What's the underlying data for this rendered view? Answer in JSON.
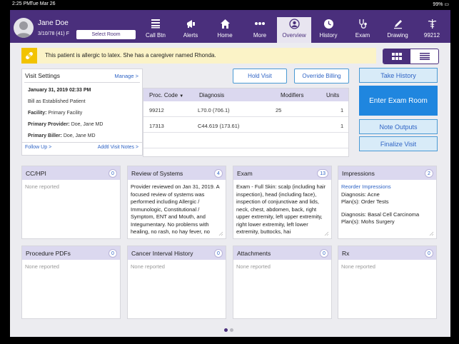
{
  "status_bar": {
    "time": "2:25 PM",
    "date": "Tue Mar 26",
    "battery": "99% ▭"
  },
  "patient": {
    "name": "Jane Doe",
    "dob": "3/10/78 (41) F",
    "select_room": "Select Room"
  },
  "nav": [
    {
      "label": "Call Btn",
      "icon": "call-button-icon"
    },
    {
      "label": "Alerts",
      "icon": "megaphone-icon"
    },
    {
      "label": "Home",
      "icon": "home-icon"
    },
    {
      "label": "More",
      "icon": "more-dots-icon"
    },
    {
      "label": "Overview",
      "icon": "person-circle-icon",
      "active": true
    },
    {
      "label": "History",
      "icon": "clock-icon"
    },
    {
      "label": "Exam",
      "icon": "stethoscope-icon"
    },
    {
      "label": "Drawing",
      "icon": "pen-icon"
    },
    {
      "label": "99212",
      "icon": "caduceus-icon"
    }
  ],
  "allergy_banner": {
    "text": "This patient is allergic to latex. She has a caregiver named Rhonda."
  },
  "visit_settings": {
    "title": "Visit Settings",
    "manage": "Manage >",
    "date": "January 31, 2019 02:33 PM",
    "bill_as": "Bill as Established Patient",
    "facility_label": "Facility:",
    "facility": "Primary Facility",
    "provider_label": "Primary Provider:",
    "provider": "Doe, Jane MD",
    "biller_label": "Primary Biller:",
    "biller": "Doe, Jane MD",
    "follow_up": "Follow Up >",
    "notes": "Addtl Visit Notes >"
  },
  "buttons": {
    "hold_visit": "Hold Visit",
    "override_billing": "Override Billing",
    "take_history": "Take History",
    "enter_exam_room": "Enter Exam Room",
    "note_outputs": "Note Outputs",
    "finalize_visit": "Finalize Visit"
  },
  "diagnosis_table": {
    "headers": {
      "proc_code": "Proc. Code",
      "diagnosis": "Diagnosis",
      "modifiers": "Modifiers",
      "units": "Units"
    },
    "rows": [
      {
        "proc_code": "99212",
        "diagnosis": "L70.0 (706.1)",
        "modifiers": "25",
        "units": "1"
      },
      {
        "proc_code": "17313",
        "diagnosis": "C44.619 (173.61)",
        "modifiers": "",
        "units": "1"
      }
    ]
  },
  "cards": {
    "cc_hpi": {
      "title": "CC/HPI",
      "count": "0",
      "empty": "None reported"
    },
    "ros": {
      "title": "Review of Systems",
      "count": "4",
      "text": "Provider reviewed on Jan 31, 2019.  A focused review of systems was performed including Allergic / Immunologic, Constitutional / Symptom, ENT and Mouth, and Integumentary. No problems with healing, no rash, no hay fever, no"
    },
    "exam": {
      "title": "Exam",
      "count": "13",
      "text": "Exam - Full Skin: scalp (including hair inspection), head (including face), inspection of conjunctivae and lids, neck, chest, abdomen, back, right upper extremity, left upper extremity, right lower extremity, left lower extremity, buttocks, hai"
    },
    "impressions": {
      "title": "Impressions",
      "count": "2",
      "reorder": "Reorder Impressions",
      "dx1": "Diagnosis: Acne",
      "plan1": "Plan(s): Order Tests",
      "dx2": "Diagnosis: Basal Cell Carcinoma",
      "plan2": "Plan(s): Mohs Surgery"
    },
    "procedure_pdfs": {
      "title": "Procedure PDFs",
      "count": "0",
      "empty": "None reported"
    },
    "cancer_interval": {
      "title": "Cancer Interval History",
      "count": "0",
      "empty": "None reported"
    },
    "attachments": {
      "title": "Attachments",
      "count": "0",
      "empty": "None reported"
    },
    "rx": {
      "title": "Rx",
      "count": "0",
      "empty": "None reported"
    }
  },
  "colors": {
    "brand_purple": "#4a2f7c",
    "accent_blue": "#1f86df",
    "link_blue": "#2f64c5",
    "allergy_yellow": "#f2c300"
  }
}
